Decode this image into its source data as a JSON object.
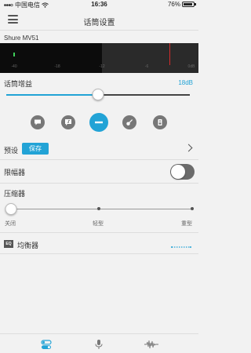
{
  "status_bar": {
    "carrier": "中国电信",
    "time": "16:36",
    "battery_percent": "76%",
    "battery_level": 0.76
  },
  "nav": {
    "title": "话筒设置",
    "menu_icon": "hamburger-menu-icon"
  },
  "device": {
    "name": "Shure MV51"
  },
  "meter": {
    "tick_labels": [
      "-40",
      "-18",
      "-12",
      "-6",
      "0dB"
    ],
    "input_level_dbfs": -48,
    "peak_db": -3
  },
  "gain": {
    "label": "话筒增益",
    "value": "18dB",
    "fraction": 0.5
  },
  "mic_modes": {
    "selected_index": 2,
    "items": [
      {
        "icon": "speech-icon"
      },
      {
        "icon": "singing-icon"
      },
      {
        "icon": "flat-icon"
      },
      {
        "icon": "acoustic-instrument-icon"
      },
      {
        "icon": "loud-icon"
      }
    ]
  },
  "preset": {
    "label": "预设",
    "save_label": "保存"
  },
  "limiter": {
    "label": "限幅器",
    "enabled": false
  },
  "compressor": {
    "label": "压缩器",
    "stops": [
      "关闭",
      "轻型",
      "重型"
    ],
    "selected_index": 0
  },
  "equalizer": {
    "badge": "EQ",
    "label": "均衡器"
  },
  "tab_bar": {
    "selected_index": 0,
    "items": [
      {
        "icon": "settings-toggles-icon"
      },
      {
        "icon": "microphone-icon"
      },
      {
        "icon": "waveform-icon"
      }
    ]
  },
  "colors": {
    "accent": "#22a3d6",
    "peak": "#d62b2b",
    "level": "#3fd05a"
  }
}
